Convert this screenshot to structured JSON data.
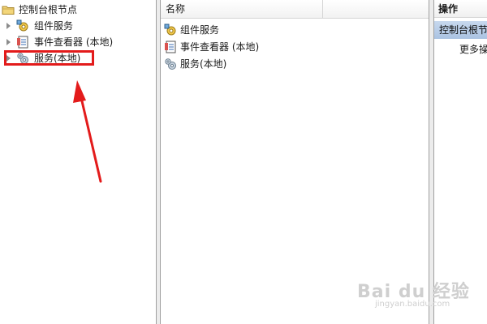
{
  "tree": {
    "root_label": "控制台根节点",
    "items": [
      {
        "label": "组件服务",
        "icon": "component-services-icon"
      },
      {
        "label": "事件查看器 (本地)",
        "icon": "event-viewer-icon"
      },
      {
        "label": "服务(本地)",
        "icon": "services-gear-icon",
        "highlighted": true
      }
    ]
  },
  "list": {
    "column_name": "名称",
    "items": [
      {
        "label": "组件服务",
        "icon": "component-services-icon"
      },
      {
        "label": "事件查看器 (本地)",
        "icon": "event-viewer-icon"
      },
      {
        "label": "服务(本地)",
        "icon": "services-gear-icon"
      }
    ]
  },
  "actions": {
    "header": "操作",
    "group_label": "控制台根节点",
    "more_label": "更多操作"
  },
  "watermark": {
    "main": "Bai du 经验",
    "sub": "jingyan.baidu.com"
  },
  "colors": {
    "highlight": "#e31b1b",
    "selection": "#aac3e2"
  }
}
